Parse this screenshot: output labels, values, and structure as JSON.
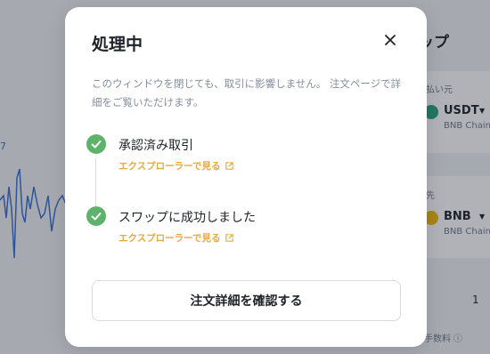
{
  "background": {
    "title": "ップ",
    "chart_tick": "7",
    "pay_label": "払い元",
    "pay_token": "USDT",
    "pay_chain": "BNB Chain",
    "receive_label": "先",
    "receive_token": "BNB",
    "receive_chain": "BNB Chain",
    "amount": "1",
    "fee_label": "プ手数料 ⓘ"
  },
  "modal": {
    "title": "処理中",
    "description": "このウィンドウを閉じても、取引に影響しません。 注文ページで詳細をご覧いただけます。",
    "steps": [
      {
        "title": "承認済み取引",
        "link": "エクスプローラーで見る",
        "status": "done"
      },
      {
        "title": "スワップに成功しました",
        "link": "エクスプローラーで見る",
        "status": "done"
      }
    ],
    "confirm_button": "注文詳細を確認する"
  },
  "colors": {
    "success": "#5eb36a",
    "link": "#e7a93c",
    "text": "#1e2329",
    "muted": "#848e9c"
  }
}
